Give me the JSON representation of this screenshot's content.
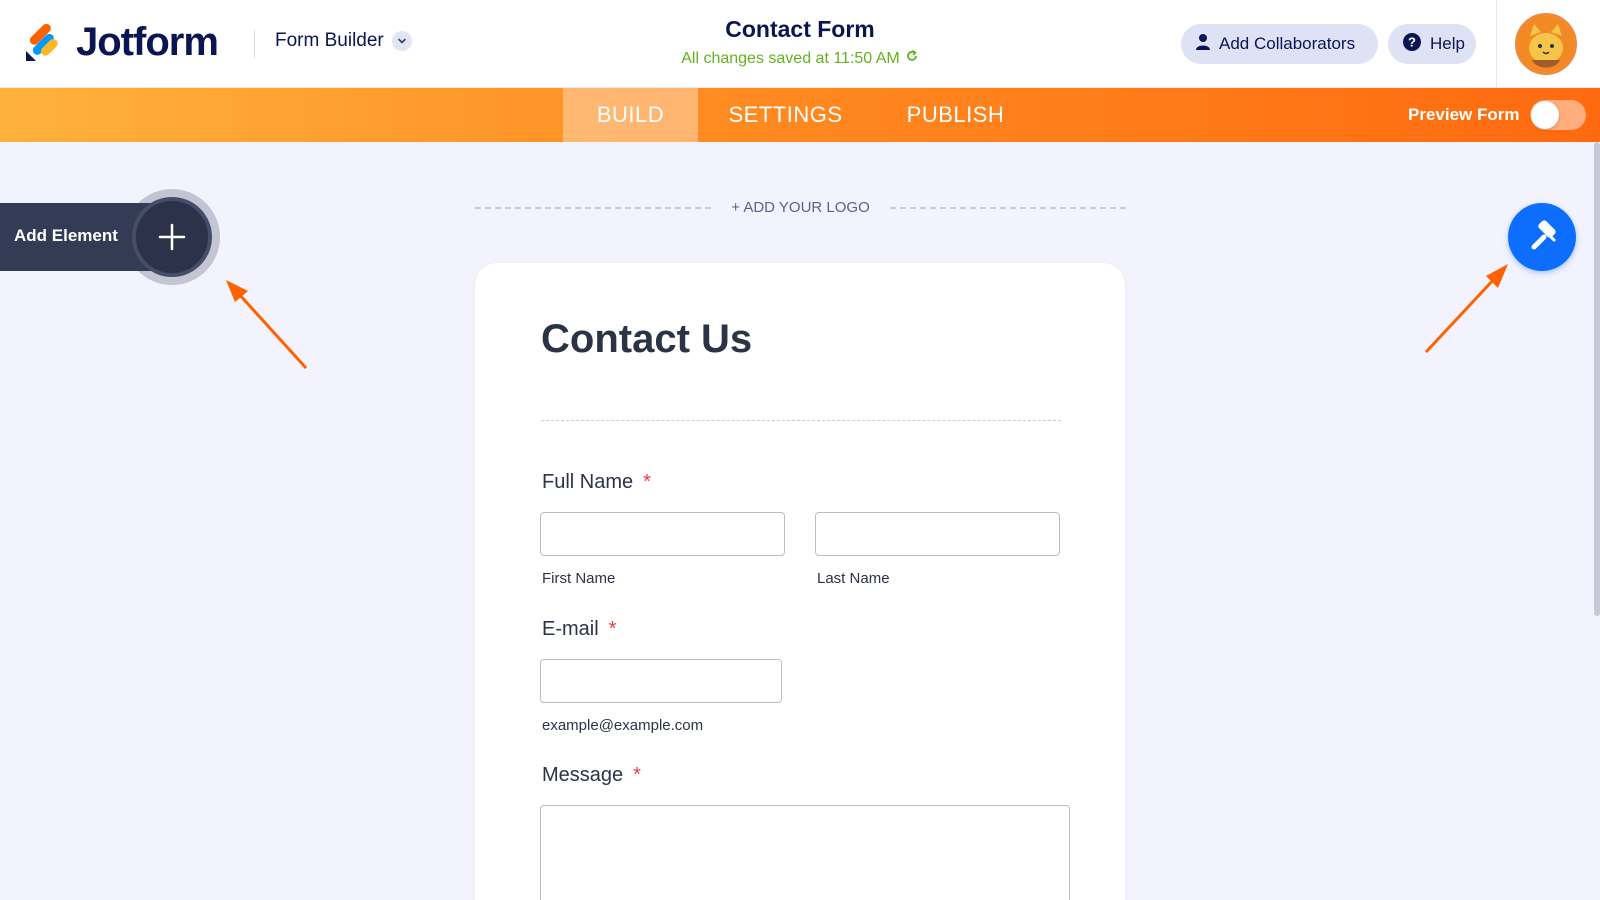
{
  "header": {
    "brand": "Jotform",
    "builder_label": "Form Builder",
    "form_title": "Contact Form",
    "save_status": "All changes saved at 11:50 AM",
    "collaborators_label": "Add Collaborators",
    "help_label": "Help"
  },
  "nav": {
    "tabs": [
      {
        "label": "BUILD",
        "active": true
      },
      {
        "label": "SETTINGS",
        "active": false
      },
      {
        "label": "PUBLISH",
        "active": false
      }
    ],
    "preview_label": "Preview Form",
    "preview_enabled": false
  },
  "canvas": {
    "add_element_label": "Add Element",
    "add_logo_label": "+ ADD YOUR LOGO"
  },
  "form": {
    "heading": "Contact Us",
    "fields": {
      "full_name": {
        "label": "Full Name",
        "required_mark": "*",
        "first_sublabel": "First Name",
        "last_sublabel": "Last Name"
      },
      "email": {
        "label": "E-mail",
        "required_mark": "*",
        "sublabel": "example@example.com"
      },
      "message": {
        "label": "Message",
        "required_mark": "*"
      }
    }
  },
  "colors": {
    "brand_navy": "#0a1551",
    "nav_orange": "#ff6a10",
    "nav_orange_light": "#ffb23d",
    "save_green": "#64b21d",
    "designer_blue": "#0d6efd",
    "required_red": "#f23a3c",
    "arrow_orange": "#ff6100"
  },
  "icons": [
    "user-icon",
    "help-icon",
    "chevron-down-icon",
    "refresh-icon",
    "plus-icon",
    "paint-roller-icon"
  ]
}
